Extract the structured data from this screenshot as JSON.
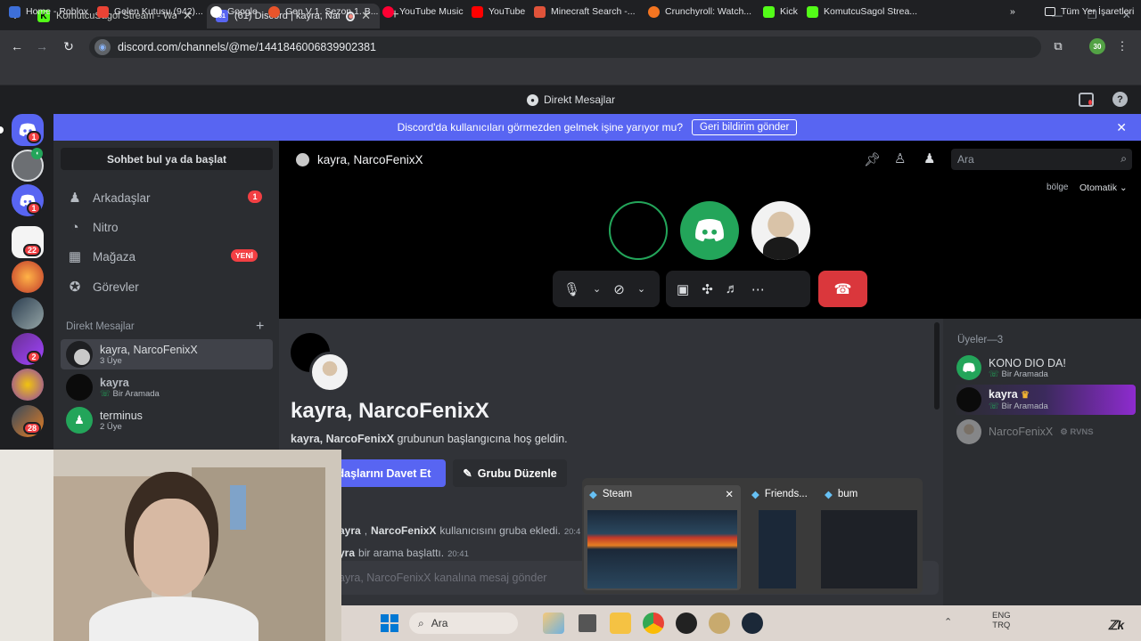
{
  "browser": {
    "tabs": [
      {
        "title": "KomutcuSagol Stream - Watch",
        "icon": "kick-logo",
        "color": "#53fc18",
        "active": false
      },
      {
        "title": "(61) Discord | kayra, NarcoF",
        "icon": "discord-logo",
        "color": "#5865f2",
        "active": true
      }
    ],
    "url": "discord.com/channels/@me/1441846006839902381",
    "profile_badge": "30",
    "bookmarks": [
      {
        "label": "Home - Roblox",
        "color": "#3d6fd9"
      },
      {
        "label": "Gelen Kutusu (942)...",
        "color": "#ea4335"
      },
      {
        "label": "Google",
        "color": "#ffffff"
      },
      {
        "label": "Gen V 1. Sezon 1. B...",
        "color": "#e8542b"
      },
      {
        "label": "YouTube Music",
        "color": "#ff0033"
      },
      {
        "label": "YouTube",
        "color": "#ff0000"
      },
      {
        "label": "Minecraft Search -...",
        "color": "#e0533a"
      },
      {
        "label": "Crunchyroll: Watch...",
        "color": "#f47521"
      },
      {
        "label": "Kick",
        "color": "#53fc18"
      },
      {
        "label": "KomutcuSagol Strea...",
        "color": "#53fc18"
      }
    ],
    "all_bookmarks": "Tüm Yer İşaretleri"
  },
  "discord": {
    "window_title": "Direkt Mesajlar",
    "banner": {
      "text": "Discord'da kullanıcıları görmezden gelmek işine yarıyor mu?",
      "button": "Geri bildirim gönder"
    },
    "servers": [
      {
        "badge": "1"
      },
      {
        "badge": ""
      },
      {
        "badge": "1"
      },
      {
        "badge": "22"
      },
      {
        "badge": ""
      },
      {
        "badge": ""
      },
      {
        "badge": "2"
      },
      {
        "badge": ""
      },
      {
        "badge": "28"
      }
    ],
    "sidebar": {
      "search": "Sohbet bul ya da başlat",
      "nav": [
        {
          "label": "Arkadaşlar",
          "badge": "1",
          "icon": "friends-icon"
        },
        {
          "label": "Nitro",
          "badge": "",
          "icon": "nitro-icon"
        },
        {
          "label": "Mağaza",
          "badge": "YENİ",
          "icon": "store-icon"
        },
        {
          "label": "Görevler",
          "badge": "",
          "icon": "quests-icon"
        }
      ],
      "dm_header": "Direkt Mesajlar",
      "dms": [
        {
          "name": "kayra, NarcoFenixX",
          "sub": "3 Üye",
          "selected": true
        },
        {
          "name": "kayra",
          "sub": "Bir Aramada",
          "selected": false
        },
        {
          "name": "terminus",
          "sub": "2 Üye",
          "selected": false
        }
      ]
    },
    "header": {
      "title": "kayra, NarcoFenixX",
      "search_placeholder": "Ara",
      "region_label": "bölge",
      "region_value": "Otomatik"
    },
    "chat": {
      "group_name": "kayra, NarcoFenixX",
      "welcome": "grubunun başlangıcına hoş geldin.",
      "invite_button": "adaşlarını Davet Et",
      "edit_button": "Grubu Düzenle",
      "msg1_name": "NarcoFenixX",
      "msg1_text": "kullanıcısını gruba ekledi.",
      "msg1_time": "20:4",
      "msg2_text": "bir arama başlattı.",
      "msg2_time": "20:41",
      "input_placeholder": "ayra, NarcoFenixX kanalına mesaj gönder"
    },
    "members": {
      "header": "Üyeler—3",
      "list": [
        {
          "name": "KONO DIO DA!",
          "sub": "Bir Aramada",
          "tag": ""
        },
        {
          "name": "kayra",
          "sub": "Bir Aramada",
          "tag": ""
        },
        {
          "name": "NarcoFenixX",
          "sub": "",
          "tag": "RVNS"
        }
      ]
    }
  },
  "thumbnails": [
    {
      "title": "Steam"
    },
    {
      "title": "Friends..."
    },
    {
      "title": "bum"
    }
  ],
  "taskbar": {
    "search": "Ara",
    "lang_top": "ENG",
    "lang_bottom": "TRQ"
  }
}
